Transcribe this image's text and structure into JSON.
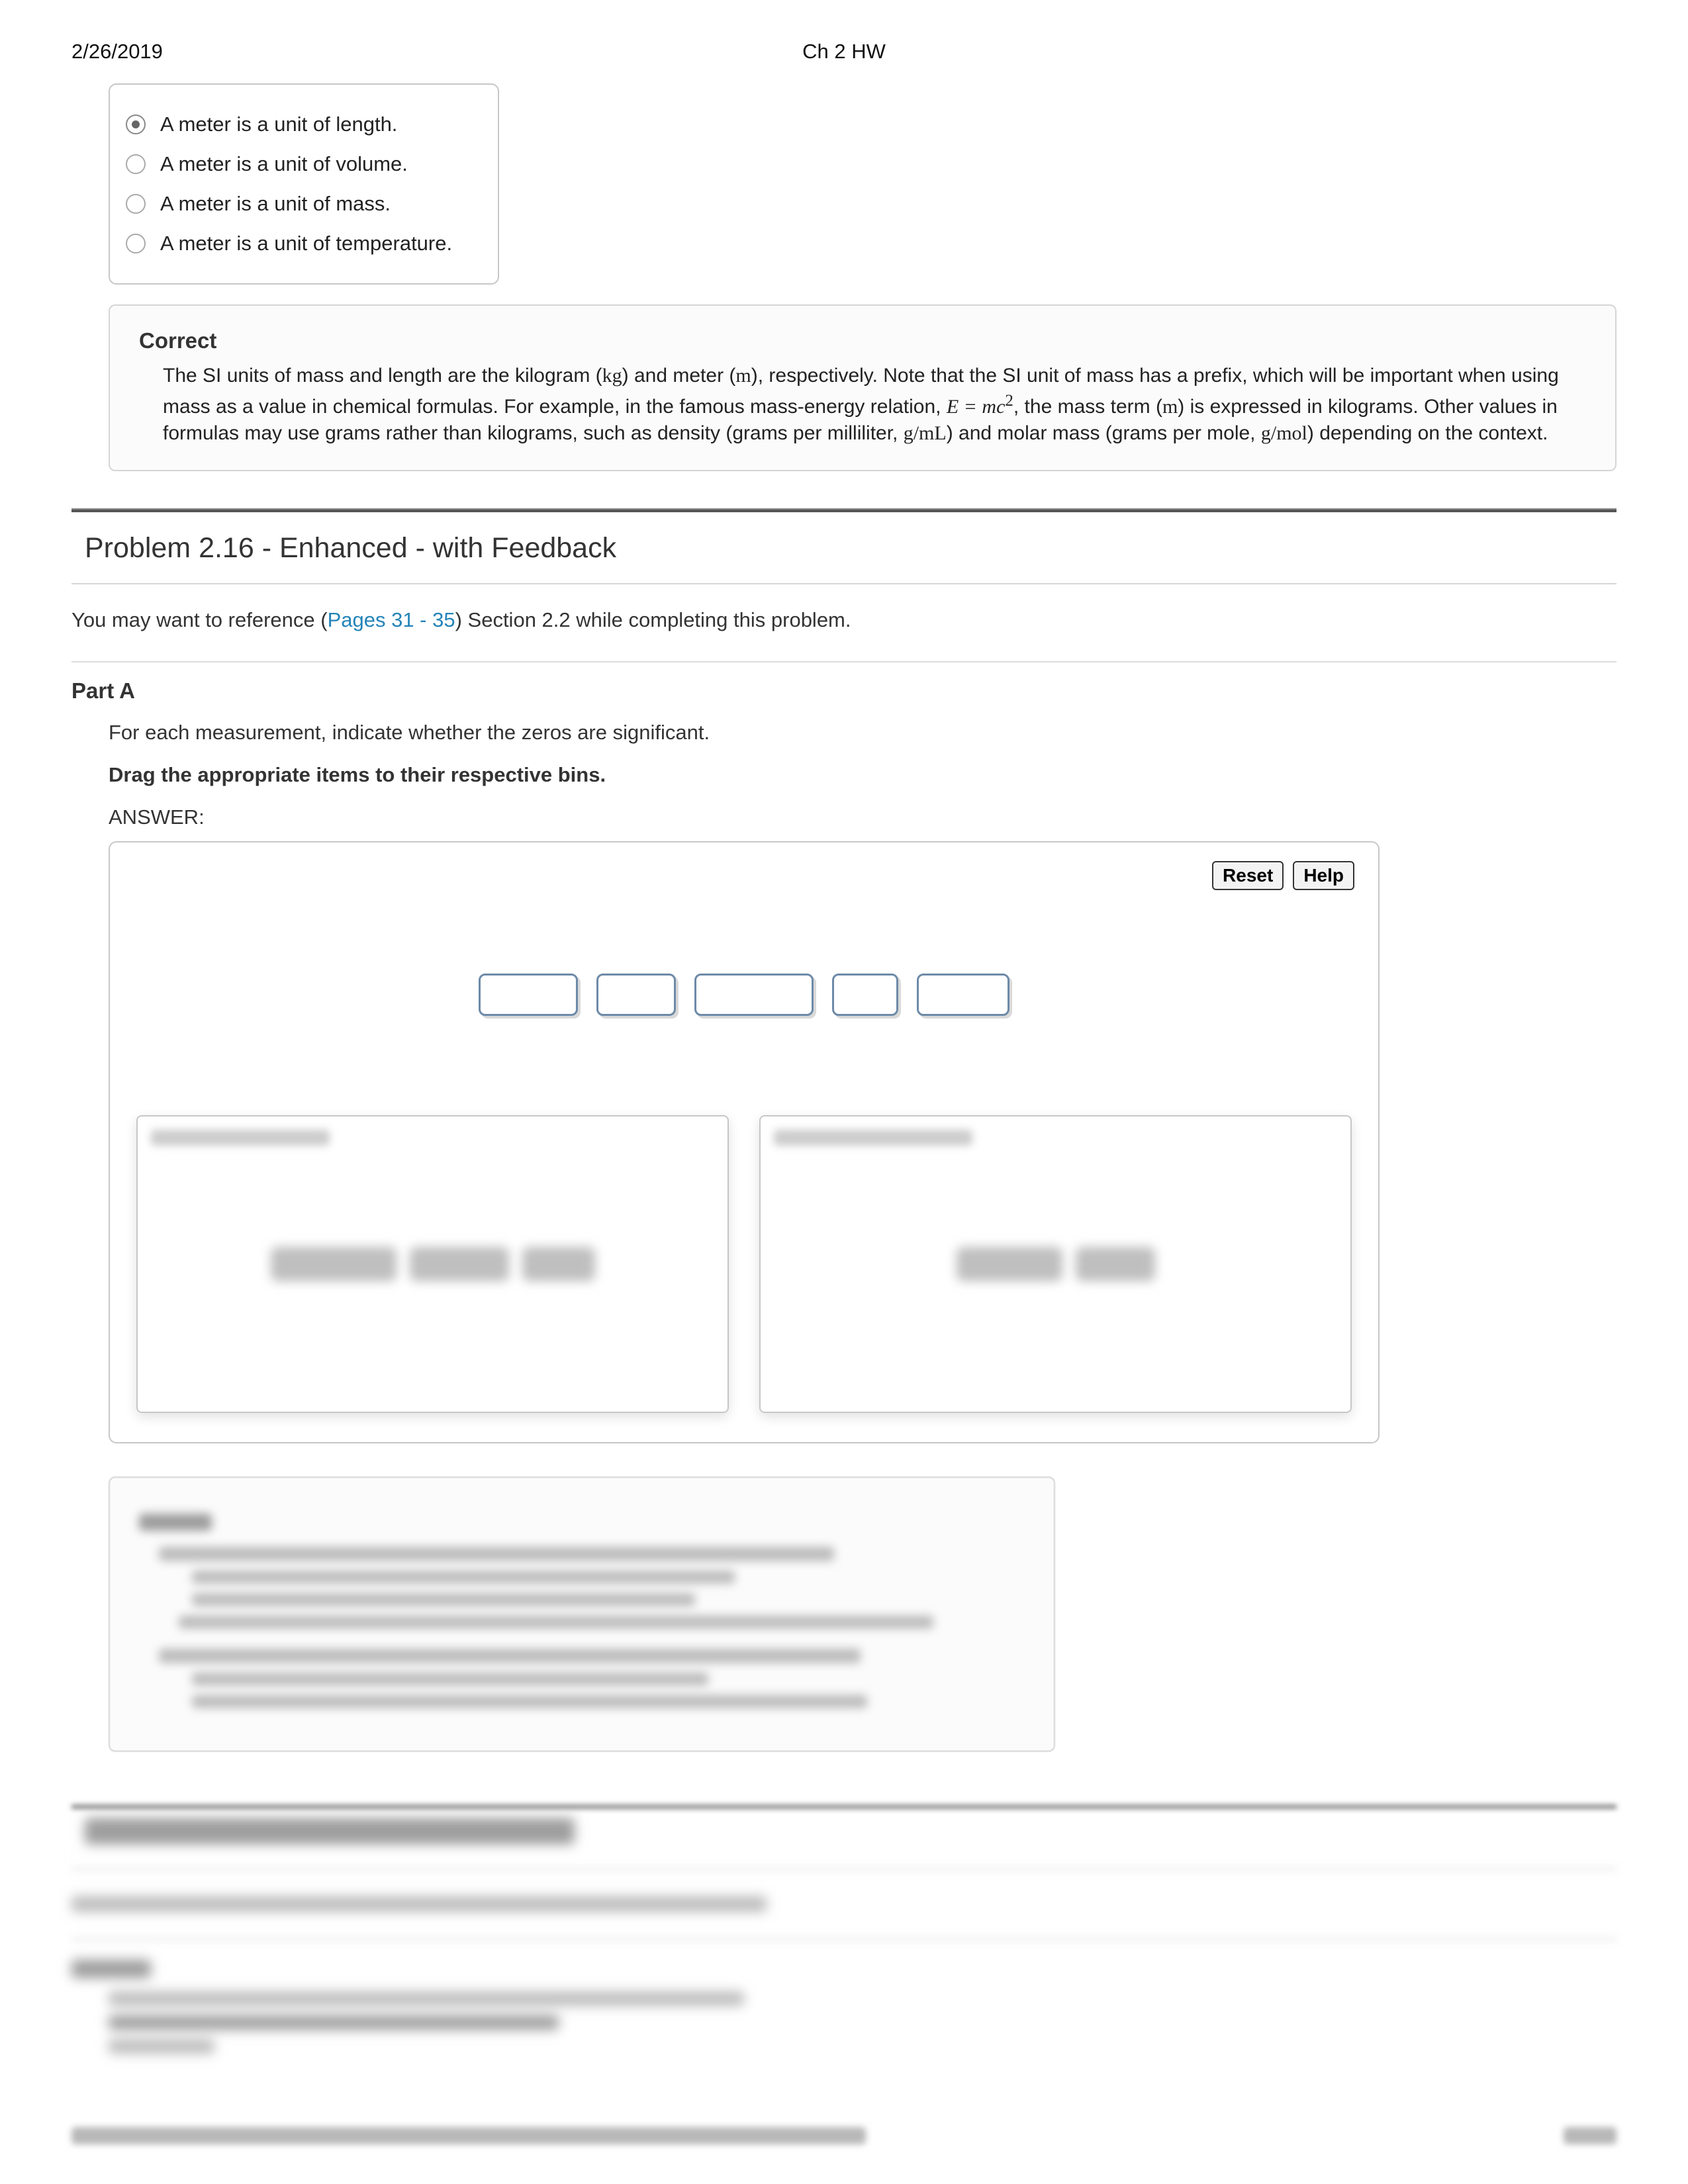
{
  "header": {
    "date": "2/26/2019",
    "title": "Ch 2 HW"
  },
  "radiocard": {
    "options": [
      {
        "label": "A meter is a unit of length.",
        "selected": true
      },
      {
        "label": "A meter is a unit of volume.",
        "selected": false
      },
      {
        "label": "A meter is a unit of mass.",
        "selected": false
      },
      {
        "label": "A meter is a unit of temperature.",
        "selected": false
      }
    ]
  },
  "feedback": {
    "title": "Correct",
    "body_pre": "The SI units of mass and length are the kilogram (",
    "kg": "kg",
    "body_mid1": ") and meter (",
    "m": "m",
    "body_mid2": "), respectively. Note that the SI unit of mass has a prefix, which will be important when using mass as a value in chemical formulas. For example, in the famous mass-energy relation, ",
    "emc": "E = mc",
    "sq": "2",
    "body_mid3": ", the mass term (",
    "m2": "m",
    "body_mid4": ") is expressed in kilograms. Other values in formulas may use grams rather than kilograms, such as density (grams per milliliter, ",
    "gml": "g/mL",
    "body_mid5": ") and molar mass (grams per mole, ",
    "gmol": "g/mol",
    "body_end": ") depending on the context."
  },
  "problem": {
    "title": "Problem 2.16 - Enhanced - with Feedback",
    "ref_pre": "You may want to reference (",
    "ref_link": "Pages 31 - 35",
    "ref_post": ") Section 2.2 while completing this problem."
  },
  "partA": {
    "label": "Part A",
    "q": "For each measurement, indicate whether the zeros are significant.",
    "instr": "Drag the appropriate items to their respective bins.",
    "answer": "ANSWER:",
    "reset": "Reset",
    "help": "Help"
  },
  "tile_widths": [
    150,
    120,
    180,
    100,
    140
  ],
  "bin1_blobs": [
    190,
    150,
    110
  ],
  "bin2_blobs": [
    160,
    120
  ]
}
